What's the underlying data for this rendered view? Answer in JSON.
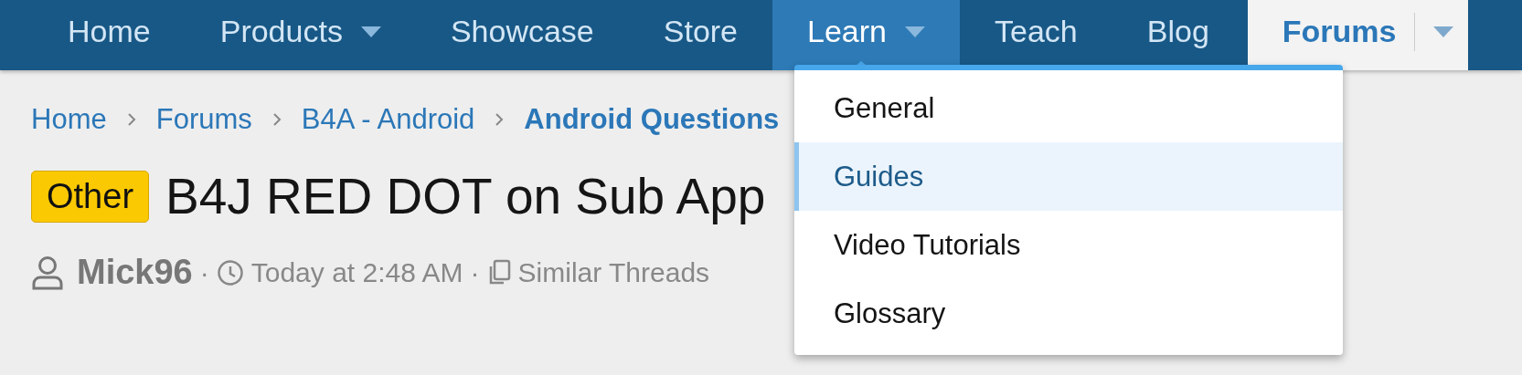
{
  "nav": {
    "items": [
      {
        "label": "Home",
        "selected": false,
        "has_menu": false
      },
      {
        "label": "Products",
        "selected": false,
        "has_menu": true
      },
      {
        "label": "Showcase",
        "selected": false,
        "has_menu": false
      },
      {
        "label": "Store",
        "selected": false,
        "has_menu": false
      },
      {
        "label": "Learn",
        "selected": false,
        "has_menu": true,
        "expanded": true
      },
      {
        "label": "Teach",
        "selected": false,
        "has_menu": false
      },
      {
        "label": "Blog",
        "selected": false,
        "has_menu": false
      },
      {
        "label": "Forums",
        "selected": true,
        "has_menu": true
      }
    ]
  },
  "breadcrumbs": [
    {
      "label": "Home",
      "current": false
    },
    {
      "label": "Forums",
      "current": false
    },
    {
      "label": "B4A - Android",
      "current": false
    },
    {
      "label": "Android Questions",
      "current": true
    }
  ],
  "thread": {
    "prefix": "Other",
    "title": "B4J RED DOT on Sub App",
    "author": "Mick96",
    "separator": "·",
    "time": "Today at 2:48 AM",
    "similar": "Similar Threads"
  },
  "dropdown": {
    "items": [
      {
        "label": "General",
        "selected": false
      },
      {
        "label": "Guides",
        "selected": true
      },
      {
        "label": "Video Tutorials",
        "selected": false
      },
      {
        "label": "Glossary",
        "selected": false
      }
    ]
  }
}
